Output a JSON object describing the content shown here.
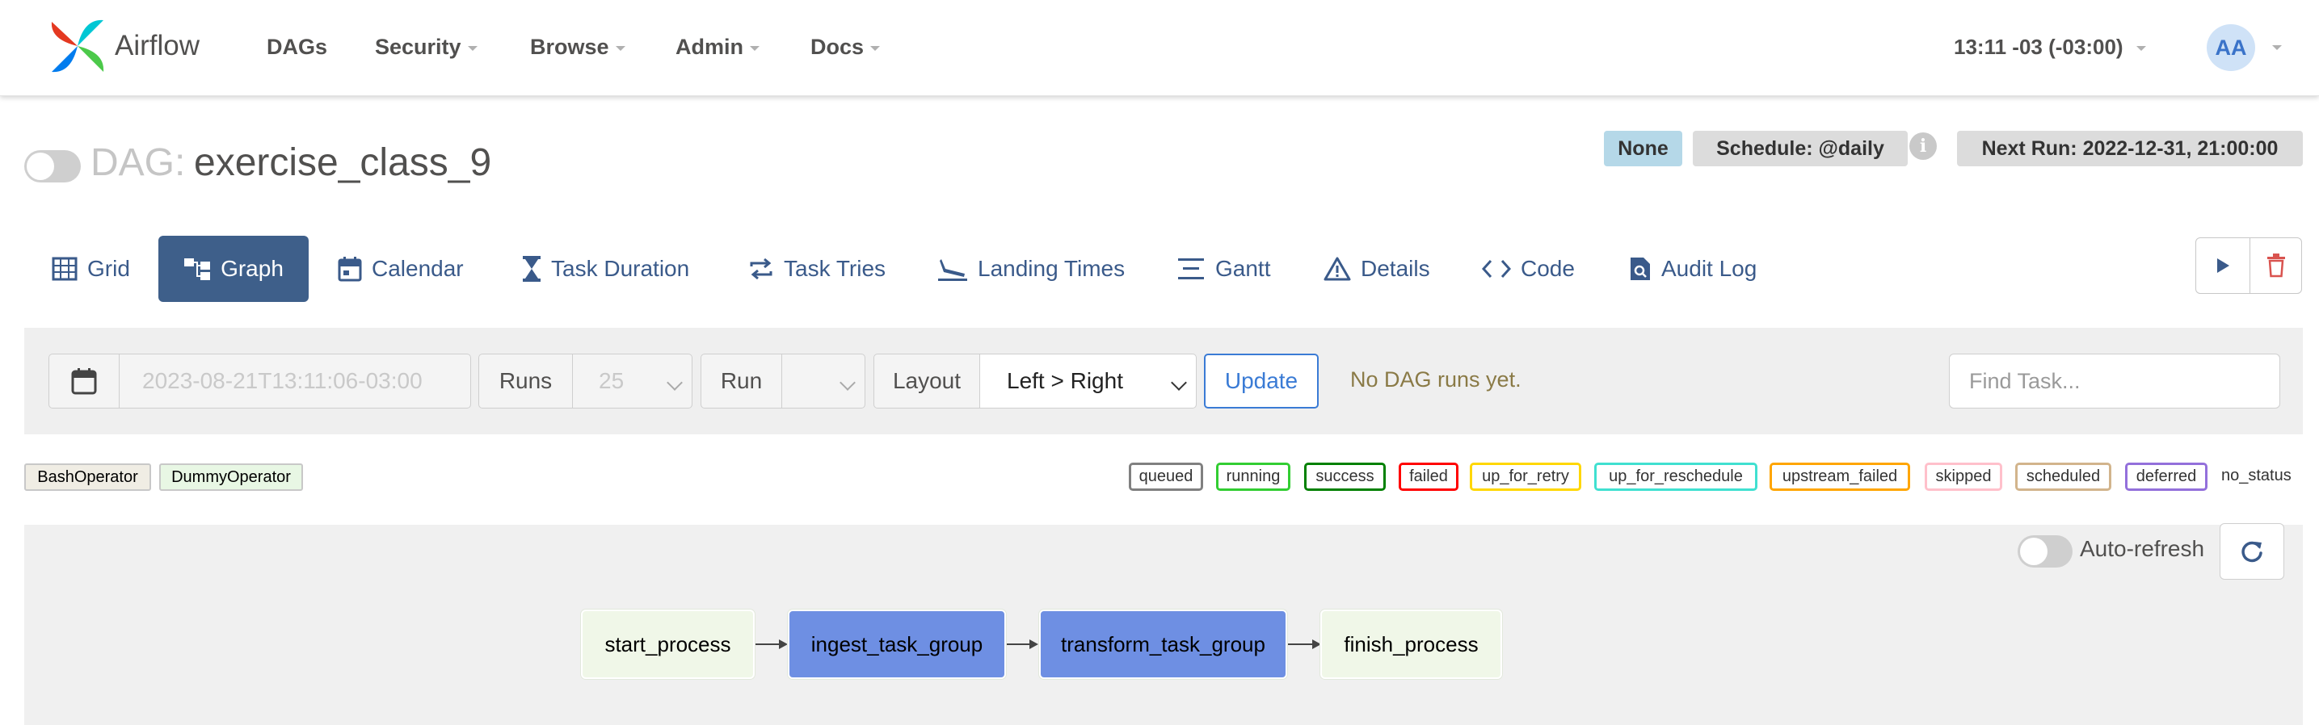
{
  "navbar": {
    "brand": "Airflow",
    "items": [
      {
        "label": "DAGs",
        "dropdown": false
      },
      {
        "label": "Security",
        "dropdown": true
      },
      {
        "label": "Browse",
        "dropdown": true
      },
      {
        "label": "Admin",
        "dropdown": true
      },
      {
        "label": "Docs",
        "dropdown": true
      }
    ],
    "clock": "13:11 -03 (-03:00)",
    "user_initials": "AA"
  },
  "dag": {
    "prefix": "DAG:",
    "name": "exercise_class_9",
    "badges": {
      "owner": "None",
      "schedule": "Schedule: @daily",
      "next_run": "Next Run: 2022-12-31, 21:00:00"
    },
    "info_glyph": "i"
  },
  "tabs": [
    {
      "label": "Grid",
      "icon": "grid-icon"
    },
    {
      "label": "Graph",
      "icon": "graph-icon",
      "active": true
    },
    {
      "label": "Calendar",
      "icon": "calendar-icon"
    },
    {
      "label": "Task Duration",
      "icon": "hourglass-icon"
    },
    {
      "label": "Task Tries",
      "icon": "retry-icon"
    },
    {
      "label": "Landing Times",
      "icon": "plane-landing-icon"
    },
    {
      "label": "Gantt",
      "icon": "gantt-icon"
    },
    {
      "label": "Details",
      "icon": "warning-triangle-icon"
    },
    {
      "label": "Code",
      "icon": "code-icon"
    },
    {
      "label": "Audit Log",
      "icon": "search-doc-icon"
    }
  ],
  "controls": {
    "base_date": "2023-08-21T13:11:06-03:00",
    "runs_label": "Runs",
    "runs_value": "25",
    "run_label": "Run",
    "run_value": "",
    "layout_label": "Layout",
    "layout_value": "Left > Right",
    "update_label": "Update",
    "no_runs_text": "No DAG runs yet.",
    "find_placeholder": "Find Task..."
  },
  "legend": {
    "operators": [
      {
        "label": "BashOperator",
        "color": "#f0ede4"
      },
      {
        "label": "DummyOperator",
        "color": "#e8f7e4"
      }
    ],
    "states": [
      {
        "label": "queued",
        "color": "#808080"
      },
      {
        "label": "running",
        "color": "#32cd32"
      },
      {
        "label": "success",
        "color": "#008000"
      },
      {
        "label": "failed",
        "color": "#ff0000"
      },
      {
        "label": "up_for_retry",
        "color": "#ffd700"
      },
      {
        "label": "up_for_reschedule",
        "color": "#40e0d0"
      },
      {
        "label": "upstream_failed",
        "color": "#ffa500"
      },
      {
        "label": "skipped",
        "color": "#ffc0cb"
      },
      {
        "label": "scheduled",
        "color": "#d2b48c"
      },
      {
        "label": "deferred",
        "color": "#9370db"
      }
    ],
    "no_status": "no_status"
  },
  "graph": {
    "auto_refresh_label": "Auto-refresh",
    "nodes": [
      {
        "label": "start_process",
        "kind": "operator"
      },
      {
        "label": "ingest_task_group",
        "kind": "group"
      },
      {
        "label": "transform_task_group",
        "kind": "group"
      },
      {
        "label": "finish_process",
        "kind": "operator"
      }
    ]
  },
  "colors": {
    "active_tab": "#3e5f8a",
    "task_group": "#6e8fe3",
    "operator_node": "#f0f7e8",
    "link": "#3a5a8a",
    "delete": "#d9534f"
  }
}
